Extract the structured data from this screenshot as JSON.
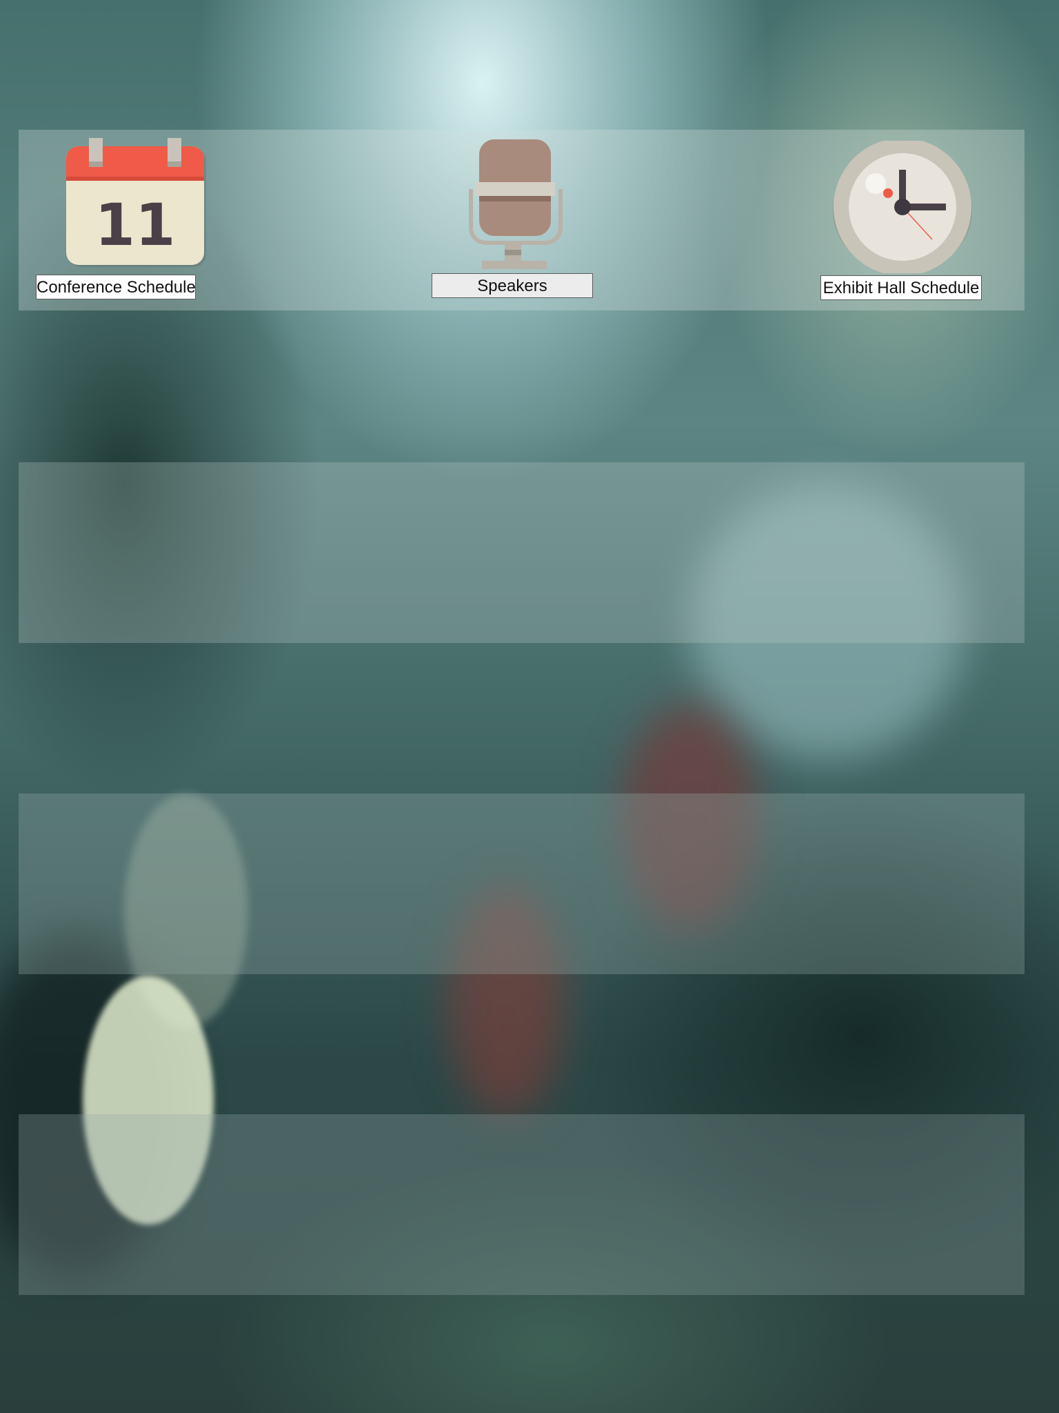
{
  "launcher": {
    "tiles": [
      {
        "label": "Conference Schedule",
        "icon": "calendar-icon",
        "calendar_day": "11"
      },
      {
        "label": "Speakers",
        "icon": "microphone-icon"
      },
      {
        "label": "Exhibit Hall Schedule",
        "icon": "clock-icon"
      }
    ]
  },
  "colors": {
    "calendar_header": "#f05a48",
    "microphone_body": "#a88b7c",
    "clock_face": "#e8e4dc"
  }
}
